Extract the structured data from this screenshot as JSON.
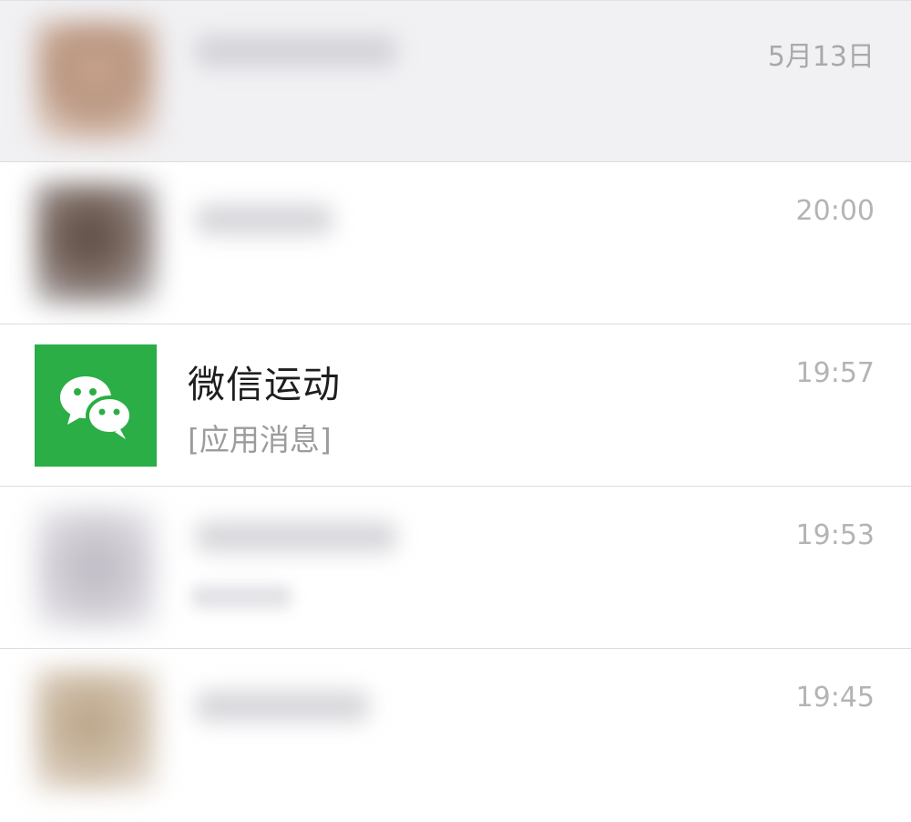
{
  "chats": [
    {
      "time": "5月13日"
    },
    {
      "time": "20:00"
    },
    {
      "name": "微信运动",
      "preview": "[应用消息]",
      "time": "19:57",
      "icon": "wechat-logo-icon",
      "accent": "#2aae45"
    },
    {
      "time": "19:53"
    },
    {
      "time": "19:45"
    }
  ]
}
